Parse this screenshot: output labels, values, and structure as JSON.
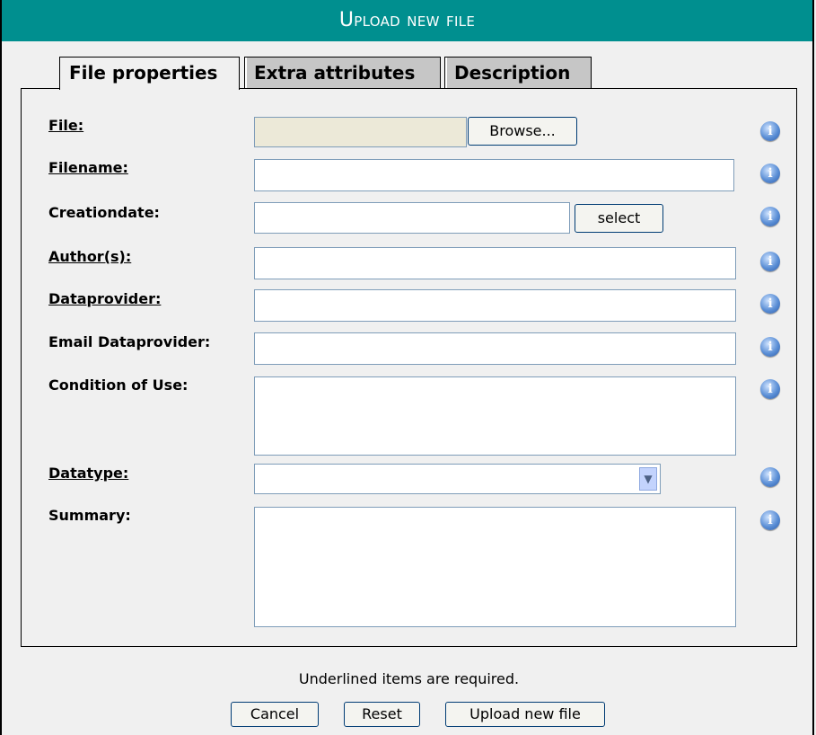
{
  "title": "Upload new file",
  "tabs": [
    "File properties",
    "Extra attributes",
    "Description"
  ],
  "fields": {
    "file": {
      "label": "File:",
      "value": "",
      "browse_label": "Browse..."
    },
    "filename": {
      "label": "Filename:",
      "value": ""
    },
    "creationdate": {
      "label": "Creationdate:",
      "value": "",
      "select_label": "select"
    },
    "authors": {
      "label": "Author(s):",
      "value": ""
    },
    "dataprovider": {
      "label": "Dataprovider:",
      "value": ""
    },
    "email_dataprovider": {
      "label": "Email Dataprovider:",
      "value": ""
    },
    "condition_of_use": {
      "label": "Condition of Use:",
      "value": ""
    },
    "datatype": {
      "label": "Datatype:",
      "value": ""
    },
    "summary": {
      "label": "Summary:",
      "value": ""
    }
  },
  "info_glyph": "i",
  "footer": {
    "note": "Underlined items are required.",
    "cancel": "Cancel",
    "reset": "Reset",
    "upload": "Upload new file"
  },
  "colors": {
    "title_bar": "#008f8f",
    "tab_inactive": "#c6c6c6",
    "input_border": "#7f9db9"
  }
}
